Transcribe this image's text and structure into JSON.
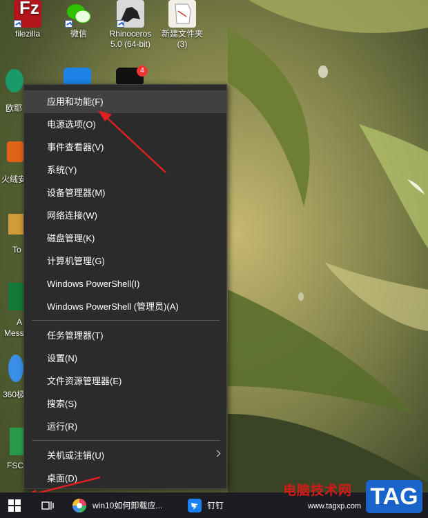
{
  "desktop": {
    "icons": [
      {
        "label": "filezilla",
        "icon": "filezilla-icon"
      },
      {
        "label": "微信",
        "icon": "wechat-icon"
      },
      {
        "label": "Rhinoceros 5.0 (64-bit)",
        "icon": "rhinoceros-icon"
      },
      {
        "label": "新建文件夹 (3)",
        "icon": "folder-icon"
      }
    ],
    "partial_labels": [
      "欧耶",
      "火绒安",
      "To",
      "A",
      "Mess",
      "360极",
      "FSCa"
    ],
    "tiktok_badge": "4"
  },
  "context_menu": {
    "items": [
      "应用和功能(F)",
      "电源选项(O)",
      "事件查看器(V)",
      "系统(Y)",
      "设备管理器(M)",
      "网络连接(W)",
      "磁盘管理(K)",
      "计算机管理(G)",
      "Windows PowerShell(I)",
      "Windows PowerShell (管理员)(A)",
      "任务管理器(T)",
      "设置(N)",
      "文件资源管理器(E)",
      "搜索(S)",
      "运行(R)",
      "关机或注销(U)",
      "桌面(D)"
    ]
  },
  "taskbar": {
    "apps": [
      {
        "label": "win10如何卸载应...",
        "icon": "browser-icon"
      },
      {
        "label": "钉钉",
        "icon": "dingtalk-icon"
      }
    ]
  },
  "watermark": {
    "site_name": "电脑技术网",
    "url": "www.tagxp.com",
    "tag": "TAG"
  },
  "colors": {
    "menu_bg": "#2b2b2b",
    "menu_hover": "#414141",
    "taskbar_bg": "#1c1d22",
    "arrow": "#e02020"
  }
}
